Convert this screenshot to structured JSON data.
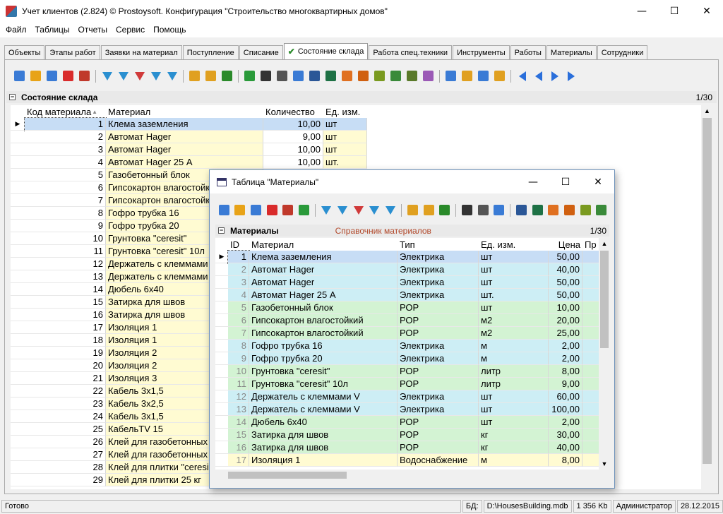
{
  "window": {
    "title": "Учет клиентов (2.824) © Prostoysoft. Конфигурация \"Строительство многоквартирных домов\"",
    "minimize": "—",
    "maximize": "☐",
    "close": "✕"
  },
  "menu": [
    "Файл",
    "Таблицы",
    "Отчеты",
    "Сервис",
    "Помощь"
  ],
  "tabs": [
    "Объекты",
    "Этапы работ",
    "Заявки на материал",
    "Поступление",
    "Списание",
    "Состояние склада",
    "Работа спец.техники",
    "Инструменты",
    "Работы",
    "Материалы",
    "Сотрудники"
  ],
  "active_tab": "Состояние склада",
  "toolbar_icons": [
    "add",
    "edit",
    "copy",
    "delete",
    "delete-all",
    "sep",
    "filter",
    "filter-clear",
    "filter-remove",
    "filter-edit",
    "filter-advanced",
    "sep",
    "find-filter",
    "group",
    "sql",
    "sep",
    "refresh",
    "find",
    "print",
    "preview",
    "export-word",
    "export-excel",
    "export-xml",
    "export-html",
    "export-dbf",
    "export-csv",
    "export-txt",
    "chart",
    "sep",
    "sort",
    "import",
    "settings",
    "columns",
    "sep",
    "first",
    "prev",
    "next",
    "last"
  ],
  "warehouse": {
    "header": "Состояние склада",
    "counter": "1/30",
    "columns": [
      "Код материала",
      "Материал",
      "Количество",
      "Ед. изм."
    ],
    "rows": [
      [
        "1",
        "Клема заземления",
        "10,00",
        "шт"
      ],
      [
        "2",
        "Автомат Hager",
        "9,00",
        "шт"
      ],
      [
        "3",
        "Автомат Hager",
        "10,00",
        "шт"
      ],
      [
        "4",
        "Автомат Hager 25 А",
        "10,00",
        "шт."
      ],
      [
        "5",
        "Газобетонный блок",
        "",
        ""
      ],
      [
        "6",
        "Гипсокартон влагостойкий",
        "",
        ""
      ],
      [
        "7",
        "Гипсокартон влагостойкий",
        "",
        ""
      ],
      [
        "8",
        "Гофро трубка 16",
        "",
        ""
      ],
      [
        "9",
        "Гофро трубка 20",
        "",
        ""
      ],
      [
        "10",
        "Грунтовка \"ceresit\"",
        "",
        ""
      ],
      [
        "11",
        "Грунтовка \"ceresit\" 10л",
        "",
        ""
      ],
      [
        "12",
        "Держатель с клеммами",
        "",
        ""
      ],
      [
        "13",
        "Держатель с клеммами",
        "",
        ""
      ],
      [
        "14",
        "Дюбель 6х40",
        "",
        ""
      ],
      [
        "15",
        "Затирка для швов",
        "",
        ""
      ],
      [
        "16",
        "Затирка для швов",
        "",
        ""
      ],
      [
        "17",
        "Изоляция 1",
        "",
        ""
      ],
      [
        "18",
        "Изоляция 1",
        "",
        ""
      ],
      [
        "19",
        "Изоляция 2",
        "",
        ""
      ],
      [
        "20",
        "Изоляция 2",
        "",
        ""
      ],
      [
        "21",
        "Изоляция 3",
        "",
        ""
      ],
      [
        "22",
        "Кабель 3х1,5",
        "",
        ""
      ],
      [
        "23",
        "Кабель 3х2,5",
        "",
        ""
      ],
      [
        "24",
        "Кабель 3х1,5",
        "",
        ""
      ],
      [
        "25",
        "КабельTV 15",
        "",
        ""
      ],
      [
        "26",
        "Клей для газобетонных",
        "",
        ""
      ],
      [
        "27",
        "Клей для газобетонных",
        "",
        ""
      ],
      [
        "28",
        "Клей для плитки \"ceresit\"",
        "",
        ""
      ],
      [
        "29",
        "Клей для плитки 25 кг",
        "",
        ""
      ]
    ]
  },
  "dialog": {
    "title": "Таблица \"Материалы\"",
    "header": "Материалы",
    "subtitle": "Справочник материалов",
    "counter": "1/30",
    "columns": [
      "ID",
      "Материал",
      "Тип",
      "Ед. изм.",
      "Цена",
      "Пр"
    ],
    "rows": [
      [
        "1",
        "Клема заземления",
        "Электрика",
        "шт",
        "50,00"
      ],
      [
        "2",
        "Автомат Hager",
        "Электрика",
        "шт",
        "40,00"
      ],
      [
        "3",
        "Автомат Hager",
        "Электрика",
        "шт",
        "50,00"
      ],
      [
        "4",
        "Автомат Hager 25 А",
        "Электрика",
        "шт.",
        "50,00"
      ],
      [
        "5",
        "Газобетонный блок",
        "РОР",
        "шт",
        "10,00"
      ],
      [
        "6",
        "Гипсокартон влагостойкий",
        "РОР",
        "м2",
        "20,00"
      ],
      [
        "7",
        "Гипсокартон влагостойкий",
        "РОР",
        "м2",
        "25,00"
      ],
      [
        "8",
        "Гофро трубка 16",
        "Электрика",
        "м",
        "2,00"
      ],
      [
        "9",
        "Гофро трубка 20",
        "Электрика",
        "м",
        "2,00"
      ],
      [
        "10",
        "Грунтовка \"ceresit\"",
        "РОР",
        "литр",
        "8,00"
      ],
      [
        "11",
        "Грунтовка \"ceresit\"  10л",
        "РОР",
        "литр",
        "9,00"
      ],
      [
        "12",
        "Держатель с клеммами V",
        "Электрика",
        "шт",
        "60,00"
      ],
      [
        "13",
        "Держатель с клеммами V",
        "Электрика",
        "шт",
        "100,00"
      ],
      [
        "14",
        "Дюбель 6х40",
        "РОР",
        "шт",
        "2,00"
      ],
      [
        "15",
        "Затирка для швов",
        "РОР",
        "кг",
        "30,00"
      ],
      [
        "16",
        "Затирка для швов",
        "РОР",
        "кг",
        "40,00"
      ],
      [
        "17",
        "Изоляция 1",
        "Водоснабжение",
        "м",
        "8,00"
      ]
    ]
  },
  "status": {
    "ready": "Готово",
    "db_label": "БД:",
    "db_path": "D:\\HousesBuilding.mdb",
    "size": "1 356 Kb",
    "user": "Администратор",
    "date": "28.12.2015"
  },
  "colors": {
    "electric": "#cdeef5",
    "pop": "#d3f3d3",
    "water": "#fffbd2",
    "pale_yellow": "#fffbd2",
    "selected": "#c7ddf5"
  },
  "icon_colors": {
    "add": "#3a7bd5",
    "edit": "#e8a317",
    "copy": "#3a7bd5",
    "delete": "#d92b2b",
    "delete-all": "#c0392b",
    "filter": "#2a8fd0",
    "filter-clear": "#2a8fd0",
    "filter-remove": "#d03a3a",
    "filter-edit": "#2a8fd0",
    "filter-advanced": "#2a8fd0",
    "find-filter": "#e0a020",
    "group": "#e0a020",
    "sql": "#2a8a2a",
    "refresh": "#2a9a3a",
    "find": "#333",
    "print": "#555",
    "preview": "#3a7bd5",
    "export-word": "#2b5797",
    "export-excel": "#1e7145",
    "export-xml": "#e07020",
    "export-html": "#d06010",
    "export-dbf": "#7a9a20",
    "export-csv": "#3a8a3a",
    "export-txt": "#5a7a2a",
    "chart": "#9b59b6",
    "sort": "#3a7bd5",
    "import": "#e0a020",
    "settings": "#3a7bd5",
    "columns": "#e0a020",
    "first": "#2a6fdb",
    "prev": "#2a6fdb",
    "next": "#2a6fdb",
    "last": "#2a6fdb"
  }
}
